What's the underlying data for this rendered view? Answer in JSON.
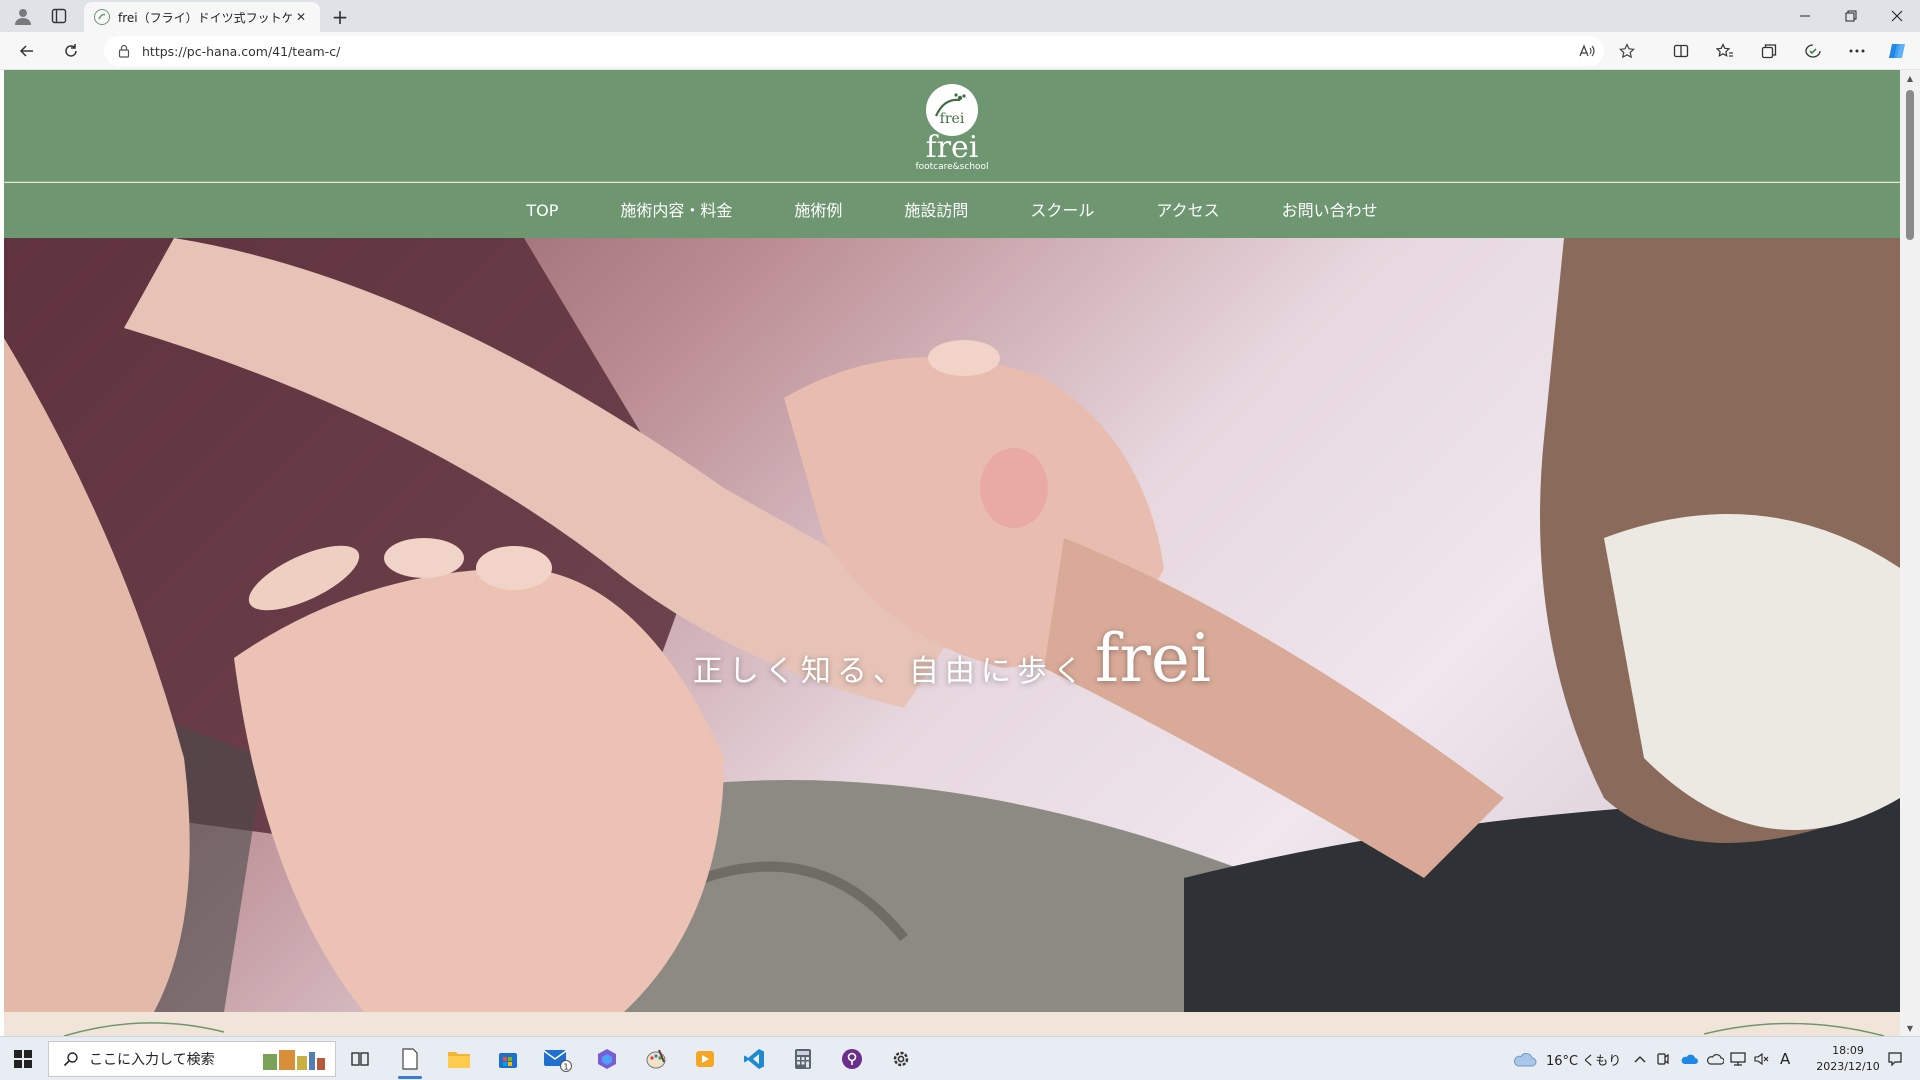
{
  "browser": {
    "tab_title": "frei（フライ）ドイツ式フットケアサロン",
    "url": "https://pc-hana.com/41/team-c/",
    "tab_close_glyph": "✕",
    "new_tab_glyph": "+"
  },
  "site": {
    "logo_word": "frei",
    "logo_sub": "footcare&school",
    "logo_mark": "frei",
    "nav": [
      "TOP",
      "施術内容・料金",
      "施術例",
      "施設訪問",
      "スクール",
      "アクセス",
      "お問い合わせ"
    ],
    "tagline_jp": "正しく知る、自由に歩く",
    "tagline_brand": "frei",
    "brand_color": "#6e9670"
  },
  "taskbar": {
    "search_placeholder": "ここに入力して検索",
    "weather": "16°C くもり",
    "ime": "A",
    "time": "18:09",
    "date": "2023/12/10",
    "mail_badge": "1"
  }
}
